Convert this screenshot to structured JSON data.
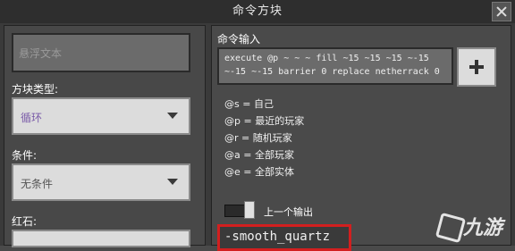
{
  "window": {
    "title": "命令方块"
  },
  "left": {
    "hover_text_placeholder": "悬浮文本",
    "block_type_label": "方块类型:",
    "block_type_value": "循环",
    "condition_label": "条件:",
    "condition_value": "无条件",
    "redstone_label": "红石:"
  },
  "right": {
    "command_label": "命令输入",
    "command_text": "execute @p ~ ~ ~ fill ~15 ~15 ~15 ~-15\n~-15 ~-15 barrier 0 replace netherrack 0",
    "selectors": [
      "@s = 自己",
      "@p = 最近的玩家",
      "@r = 随机玩家",
      "@a = 全部玩家",
      "@e = 全部实体"
    ],
    "previous_output_label": "上一个输出",
    "output_text": "-smooth_quartz"
  },
  "watermark": {
    "text": "九游"
  },
  "colors": {
    "highlight_border": "#d21f1f",
    "dropdown_accent": "#7a5ba8"
  }
}
